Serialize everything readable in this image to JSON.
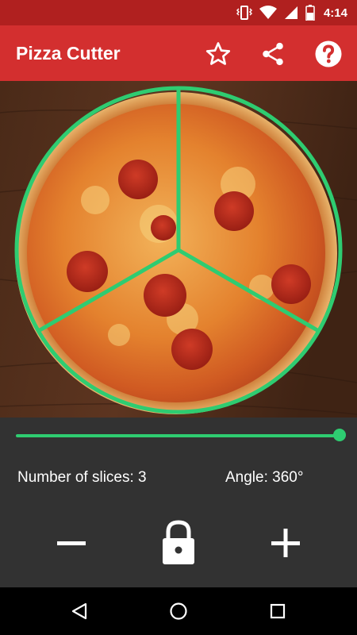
{
  "status_bar": {
    "time": "4:14",
    "icons": [
      "vibrate-icon",
      "wifi-icon",
      "cellular-signal-icon",
      "battery-icon"
    ]
  },
  "app_bar": {
    "title": "Pizza Cutter",
    "background": "#d32f2f",
    "actions": [
      "star-icon",
      "share-icon",
      "help-icon"
    ]
  },
  "pizza": {
    "slices": 3,
    "cut_color": "#2ecc71"
  },
  "controls": {
    "slider_fraction": 1.0,
    "slices_label": "Number of slices: 3",
    "angle_label": "Angle: 360°",
    "buttons": [
      "minus-icon",
      "lock-icon",
      "plus-icon"
    ]
  },
  "nav_bar": {
    "buttons": [
      "back-icon",
      "home-icon",
      "recents-icon"
    ]
  }
}
